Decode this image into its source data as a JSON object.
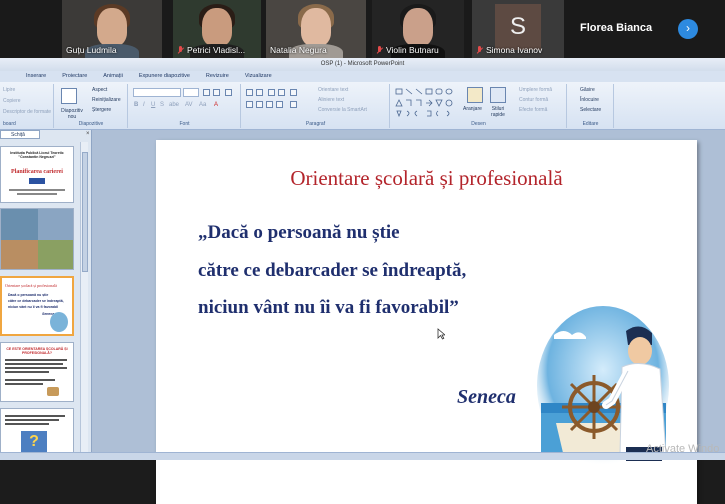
{
  "conference": {
    "participants": [
      {
        "name": "Guțu Ludmila",
        "muted": false
      },
      {
        "name": "Petrici Vladisl...",
        "muted": true
      },
      {
        "name": "Natalia Negura",
        "muted": false
      },
      {
        "name": "Violin Butnaru",
        "muted": true
      },
      {
        "name": "Simona Ivanov",
        "muted": true,
        "initial": "S"
      },
      {
        "name": "Florea Bianca",
        "muted": false
      }
    ],
    "next_icon": "chevron-right-icon"
  },
  "ppt": {
    "window_title": "OSP (1) - Microsoft PowerPoint",
    "tabs": [
      "Inserare",
      "Proiectare",
      "Animații",
      "Expunere diapozitive",
      "Revizuire",
      "Vizualizare"
    ],
    "ribbon": {
      "clipboard_items": [
        "Lipire",
        "Copiere",
        "Descriptor de formate"
      ],
      "clipboard_label": "board",
      "slides_new": "Diapozitiv nou",
      "slides_items": [
        "Aspect",
        "Reinițializare",
        "Ștergere"
      ],
      "slides_label": "Diapozitive",
      "font_label": "Font",
      "paragraph_items": [
        "Orientare text",
        "Aliniere text",
        "Conversie la SmartArt"
      ],
      "paragraph_label": "Paragraf",
      "drawing_arrange": "Aranjare",
      "drawing_styles": "Stiluri rapide",
      "drawing_items": [
        "Umplere formă",
        "Contur formă",
        "Efecte formă"
      ],
      "drawing_label": "Desen",
      "editing_items": [
        "Găsire",
        "Înlocuire",
        "Selectare"
      ],
      "editing_label": "Editare"
    },
    "panel": {
      "tab_label": "Schiță",
      "thumbnails": [
        {
          "lines": [
            "Instituția Publică Liceul Teoretic \"Constantin Negruzzi\"",
            "Planificarea carierei"
          ]
        },
        {
          "lines": []
        },
        {
          "lines": [
            "Orientare școlară și profesională",
            "Dacă o persoană nu știe",
            "către ce debarcader se îndreaptă,",
            "niciun vânt nu îi va fi favorabil",
            "Seneca"
          ]
        },
        {
          "lines": [
            "CE ESTE ORIENTAREA ȘCOLARĂ ȘI PROFESIONALĂ?"
          ]
        },
        {
          "lines": []
        }
      ]
    },
    "slide": {
      "title": "Orientare școlară și profesională",
      "quote_lines": [
        "„Dacă o persoană nu știe",
        "către ce debarcader se îndreaptă,",
        "niciun vânt nu îi va fi favorabil”"
      ],
      "author": "Seneca"
    }
  },
  "watermark": "Activate Windo",
  "colors": {
    "title_red": "#b3242b",
    "quote_navy": "#1f2f6e",
    "accent_blue": "#2d8ae0"
  }
}
